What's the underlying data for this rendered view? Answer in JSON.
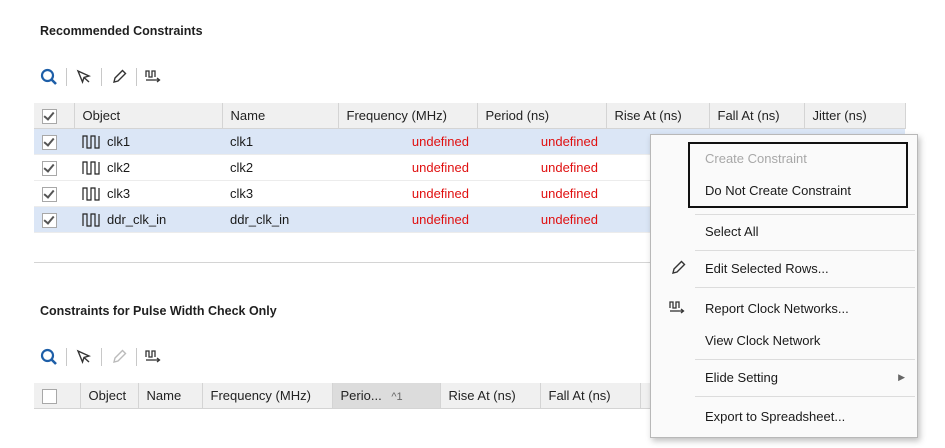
{
  "recommended": {
    "title": "Recommended Constraints",
    "columns": [
      "Object",
      "Name",
      "Frequency (MHz)",
      "Period (ns)",
      "Rise At (ns)",
      "Fall At (ns)",
      "Jitter (ns)"
    ],
    "rows": [
      {
        "object": "clk1",
        "name": "clk1",
        "frequency": "undefined",
        "period": "undefined",
        "checked": true,
        "selected": true
      },
      {
        "object": "clk2",
        "name": "clk2",
        "frequency": "undefined",
        "period": "undefined",
        "checked": true,
        "selected": false
      },
      {
        "object": "clk3",
        "name": "clk3",
        "frequency": "undefined",
        "period": "undefined",
        "checked": true,
        "selected": false
      },
      {
        "object": "ddr_clk_in",
        "name": "ddr_clk_in",
        "frequency": "undefined",
        "period": "undefined",
        "checked": true,
        "selected": true
      }
    ]
  },
  "pulse": {
    "title": "Constraints for Pulse Width Check Only",
    "columns": [
      "Object",
      "Name",
      "Frequency (MHz)",
      "Perio...",
      "Rise At (ns)",
      "Fall At (ns)"
    ],
    "sort_indicator": "^1"
  },
  "context_menu": {
    "items": [
      {
        "label": "Create Constraint",
        "disabled": true
      },
      {
        "label": "Do Not Create Constraint"
      },
      {
        "label": "Select All"
      },
      {
        "label": "Edit Selected Rows...",
        "icon": "pencil-icon"
      },
      {
        "label": "Report Clock Networks...",
        "icon": "clock-network-icon"
      },
      {
        "label": "View Clock Network"
      },
      {
        "label": "Elide Setting",
        "submenu": true
      },
      {
        "label": "Export to Spreadsheet..."
      }
    ]
  },
  "colors": {
    "undefined_text": "#e01010",
    "selected_row": "#dbe6f6",
    "header_bg": "#f0f0f0"
  }
}
